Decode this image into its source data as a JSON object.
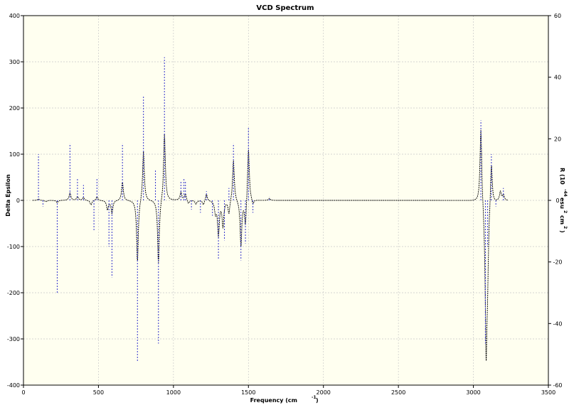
{
  "chart_data": {
    "type": "line",
    "title": "VCD Spectrum",
    "xlabel": "Frequency (cm",
    "xlabel_sup": "-1",
    "xlabel_close": ")",
    "ylabel": "Delta Epsilon",
    "y2label_parts": [
      "R (10",
      "-44",
      "esu",
      "2",
      "cm",
      "2",
      ")"
    ],
    "xlim": [
      0,
      3500
    ],
    "ylim": [
      -400,
      400
    ],
    "y2lim": [
      -60,
      60
    ],
    "x_ticks": [
      "0",
      "500",
      "1000",
      "1500",
      "2000",
      "2500",
      "3000",
      "3500"
    ],
    "y_ticks": [
      "400",
      "300",
      "200",
      "100",
      "0",
      "-100",
      "-200",
      "-300",
      "-400"
    ],
    "y2_ticks": [
      "60",
      "40",
      "20",
      "0",
      "-20",
      "-40",
      "-60"
    ],
    "grid": true,
    "background_color": "#fffff0",
    "series": [
      {
        "style": "spectrum-curve",
        "color": "#000000",
        "dash": "2,1",
        "peaks": [
          [
            100,
            3
          ],
          [
            150,
            -3
          ],
          [
            225,
            -5
          ],
          [
            310,
            16
          ],
          [
            360,
            8
          ],
          [
            400,
            6
          ],
          [
            450,
            -10
          ],
          [
            490,
            8
          ],
          [
            560,
            -20
          ],
          [
            590,
            -28
          ],
          [
            660,
            40
          ],
          [
            760,
            -135
          ],
          [
            800,
            110
          ],
          [
            900,
            -140
          ],
          [
            940,
            148
          ],
          [
            1050,
            18
          ],
          [
            1080,
            14
          ],
          [
            1100,
            -8
          ],
          [
            1150,
            -8
          ],
          [
            1200,
            -10
          ],
          [
            1220,
            15
          ],
          [
            1280,
            -25
          ],
          [
            1300,
            -75
          ],
          [
            1330,
            -55
          ],
          [
            1370,
            -30
          ],
          [
            1400,
            90
          ],
          [
            1450,
            -100
          ],
          [
            1480,
            -60
          ],
          [
            1500,
            118
          ],
          [
            1530,
            -12
          ],
          [
            1640,
            4
          ],
          [
            3050,
            168
          ],
          [
            3075,
            -25
          ],
          [
            3085,
            -310
          ],
          [
            3095,
            -120
          ],
          [
            3120,
            95
          ],
          [
            3180,
            20
          ],
          [
            3200,
            12
          ]
        ]
      },
      {
        "style": "rotational-strength-sticks",
        "color": "#3232cc",
        "dash": "2,2",
        "sticks": [
          [
            100,
            15
          ],
          [
            130,
            -2
          ],
          [
            225,
            -30
          ],
          [
            310,
            18.5
          ],
          [
            360,
            7
          ],
          [
            400,
            5
          ],
          [
            470,
            -10
          ],
          [
            490,
            7
          ],
          [
            570,
            -15
          ],
          [
            590,
            -25
          ],
          [
            660,
            18.5
          ],
          [
            760,
            -52.5
          ],
          [
            800,
            34
          ],
          [
            880,
            10
          ],
          [
            900,
            -46.5
          ],
          [
            940,
            46.5
          ],
          [
            1050,
            6
          ],
          [
            1070,
            7
          ],
          [
            1080,
            6
          ],
          [
            1120,
            -3
          ],
          [
            1180,
            -4
          ],
          [
            1220,
            3
          ],
          [
            1260,
            -5
          ],
          [
            1300,
            -19
          ],
          [
            1340,
            -13
          ],
          [
            1370,
            4
          ],
          [
            1400,
            18.5
          ],
          [
            1450,
            -19.5
          ],
          [
            1480,
            -14
          ],
          [
            1500,
            23.5
          ],
          [
            1530,
            -4
          ],
          [
            1640,
            1
          ],
          [
            3050,
            26
          ],
          [
            3080,
            -46.5
          ],
          [
            3095,
            -15
          ],
          [
            3120,
            15
          ],
          [
            3150,
            -2
          ],
          [
            3200,
            4
          ]
        ]
      }
    ]
  }
}
